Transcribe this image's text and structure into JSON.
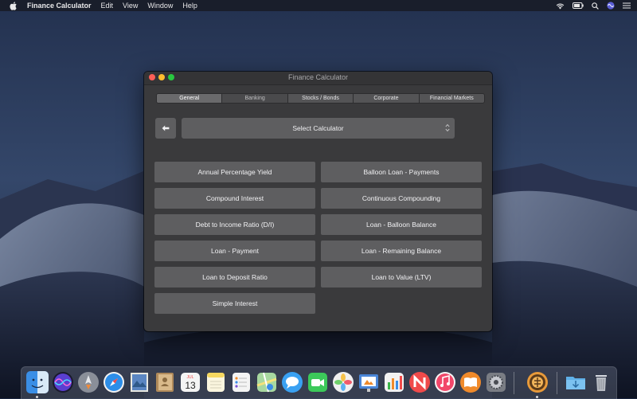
{
  "menubar": {
    "app_name": "Finance Calculator",
    "items": [
      "Edit",
      "View",
      "Window",
      "Help"
    ]
  },
  "window": {
    "title": "Finance Calculator",
    "tabs": [
      {
        "label": "General",
        "state": "selected"
      },
      {
        "label": "Banking",
        "state": "dim"
      },
      {
        "label": "Stocks / Bonds",
        "state": "normal"
      },
      {
        "label": "Corporate",
        "state": "normal"
      },
      {
        "label": "Financial Markets",
        "state": "normal"
      }
    ],
    "select_label": "Select Calculator",
    "calculators": [
      "Annual Percentage Yield",
      "Balloon Loan - Payments",
      "Compound Interest",
      "Continuous Compounding",
      "Debt to Income Ratio (D/I)",
      "Loan - Balloon Balance",
      "Loan - Payment",
      "Loan - Remaining Balance",
      "Loan to Deposit Ratio",
      "Loan to Value (LTV)",
      "Simple Interest"
    ]
  },
  "dock": {
    "apps": [
      {
        "name": "finder-icon",
        "color": "#3a8ee6"
      },
      {
        "name": "siri-icon",
        "color": "#7a4fd6"
      },
      {
        "name": "launchpad-icon",
        "color": "#8a8f99"
      },
      {
        "name": "safari-icon",
        "color": "#2d8ee8"
      },
      {
        "name": "mail-stamp-icon",
        "color": "#5b86c2"
      },
      {
        "name": "contacts-icon",
        "color": "#b08a5a"
      },
      {
        "name": "calendar-icon",
        "color": "#f4f4f4"
      },
      {
        "name": "notes-icon",
        "color": "#f6d860"
      },
      {
        "name": "reminders-icon",
        "color": "#f4f4f4"
      },
      {
        "name": "maps-icon",
        "color": "#6fbf6a"
      },
      {
        "name": "messages-icon",
        "color": "#3aa1f2"
      },
      {
        "name": "facetime-icon",
        "color": "#3cc95a"
      },
      {
        "name": "photos-icon",
        "color": "#f0f0f0"
      },
      {
        "name": "keynote-icon",
        "color": "#4a86d8"
      },
      {
        "name": "numbers-icon",
        "color": "#3cb54a"
      },
      {
        "name": "news-icon",
        "color": "#f04a4a"
      },
      {
        "name": "music-icon",
        "color": "#f2476a"
      },
      {
        "name": "books-icon",
        "color": "#f08a2a"
      },
      {
        "name": "system-preferences-icon",
        "color": "#7a7d84"
      },
      {
        "name": "finance-calculator-icon",
        "color": "#e89a3a"
      },
      {
        "name": "downloads-folder-icon",
        "color": "#5fb0e8"
      },
      {
        "name": "trash-icon",
        "color": "#b8bcc4"
      }
    ],
    "calendar_day": "13",
    "calendar_month": "JUL"
  }
}
